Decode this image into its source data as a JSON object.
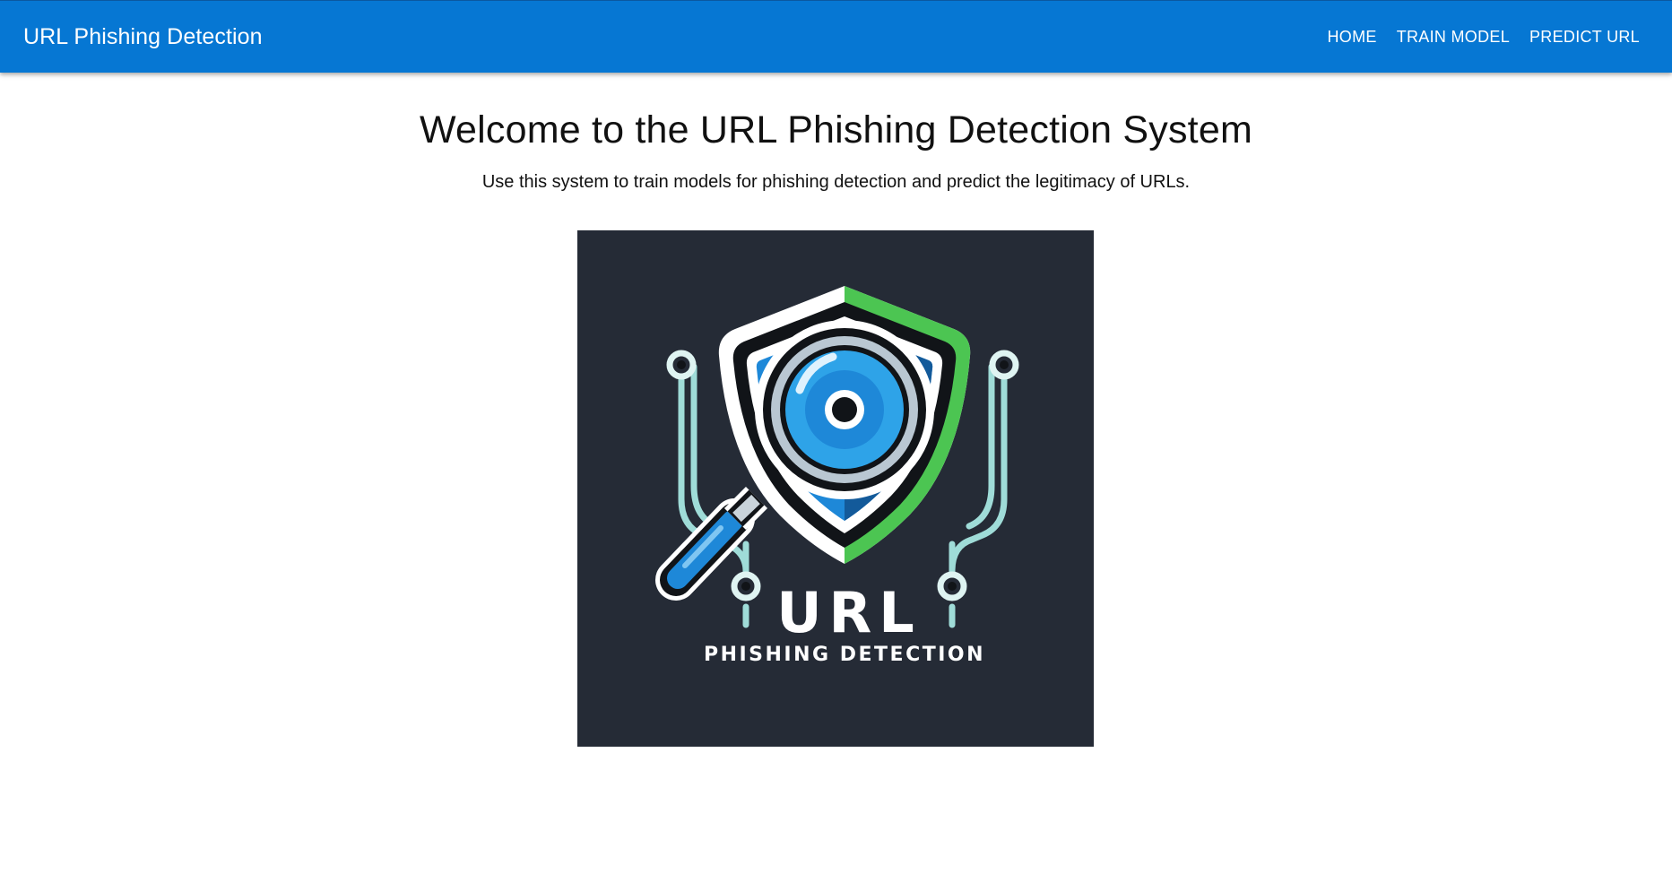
{
  "header": {
    "brand": "URL Phishing Detection",
    "nav": [
      {
        "label": "HOME"
      },
      {
        "label": "TRAIN MODEL"
      },
      {
        "label": "PREDICT URL"
      }
    ]
  },
  "main": {
    "title": "Welcome to the URL Phishing Detection System",
    "subtitle": "Use this system to train models for phishing detection and predict the legitimacy of URLs.",
    "logo": {
      "line1": "URL",
      "line2": "PHISHING DETECTION"
    }
  },
  "colors": {
    "appbar": "#0677d3",
    "logo_bg": "#252b36",
    "shield_blue": "#1e88d8",
    "shield_green": "#4cc552",
    "circuit": "#9fdcd8"
  }
}
